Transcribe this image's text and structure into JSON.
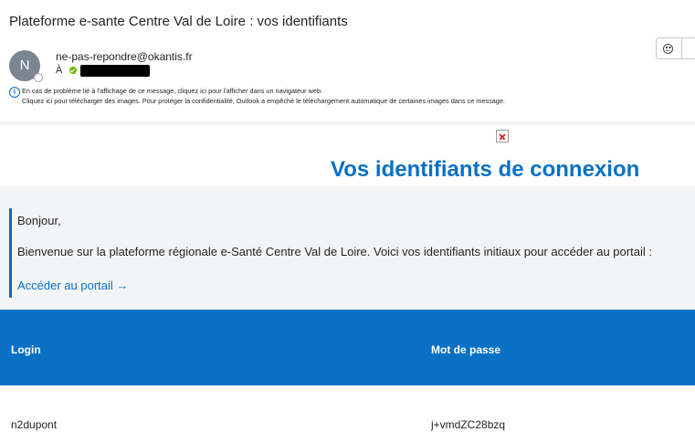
{
  "email": {
    "subject": "Plateforme e-sante Centre Val de Loire : vos identifiants",
    "sender": {
      "initial": "N",
      "address": "ne-pas-repondre@okantis.fr"
    },
    "to_label": "À"
  },
  "notice": {
    "line1": "En cas de problème lié à l'affichage de ce message, cliquez ici pour l'afficher dans un navigateur web.",
    "line2": "Cliquez ici pour télécharger des images. Pour protéger la confidentialité, Outlook a empêché le téléchargement automatique de certaines images dans ce message."
  },
  "body": {
    "headline": "Vos identifiants de connexion",
    "greeting": "Bonjour,",
    "welcome": "Bienvenue sur la plateforme régionale e-Santé Centre Val de Loire. Voici vos identifiants initiaux pour accéder au portail :",
    "portal_link": "Accéder au portail →"
  },
  "credentials": {
    "headers": {
      "login": "Login",
      "password": "Mot de passe"
    },
    "rows": [
      {
        "login": "n2dupont",
        "password": "j+vmdZC28bzq"
      }
    ]
  },
  "colors": {
    "accent": "#0a70c4",
    "panel": "#f3f4f6",
    "presence": "#6bb700"
  },
  "icons": [
    "avatar",
    "presence-check-icon",
    "smiley-icon",
    "info-icon",
    "broken-image-icon"
  ]
}
